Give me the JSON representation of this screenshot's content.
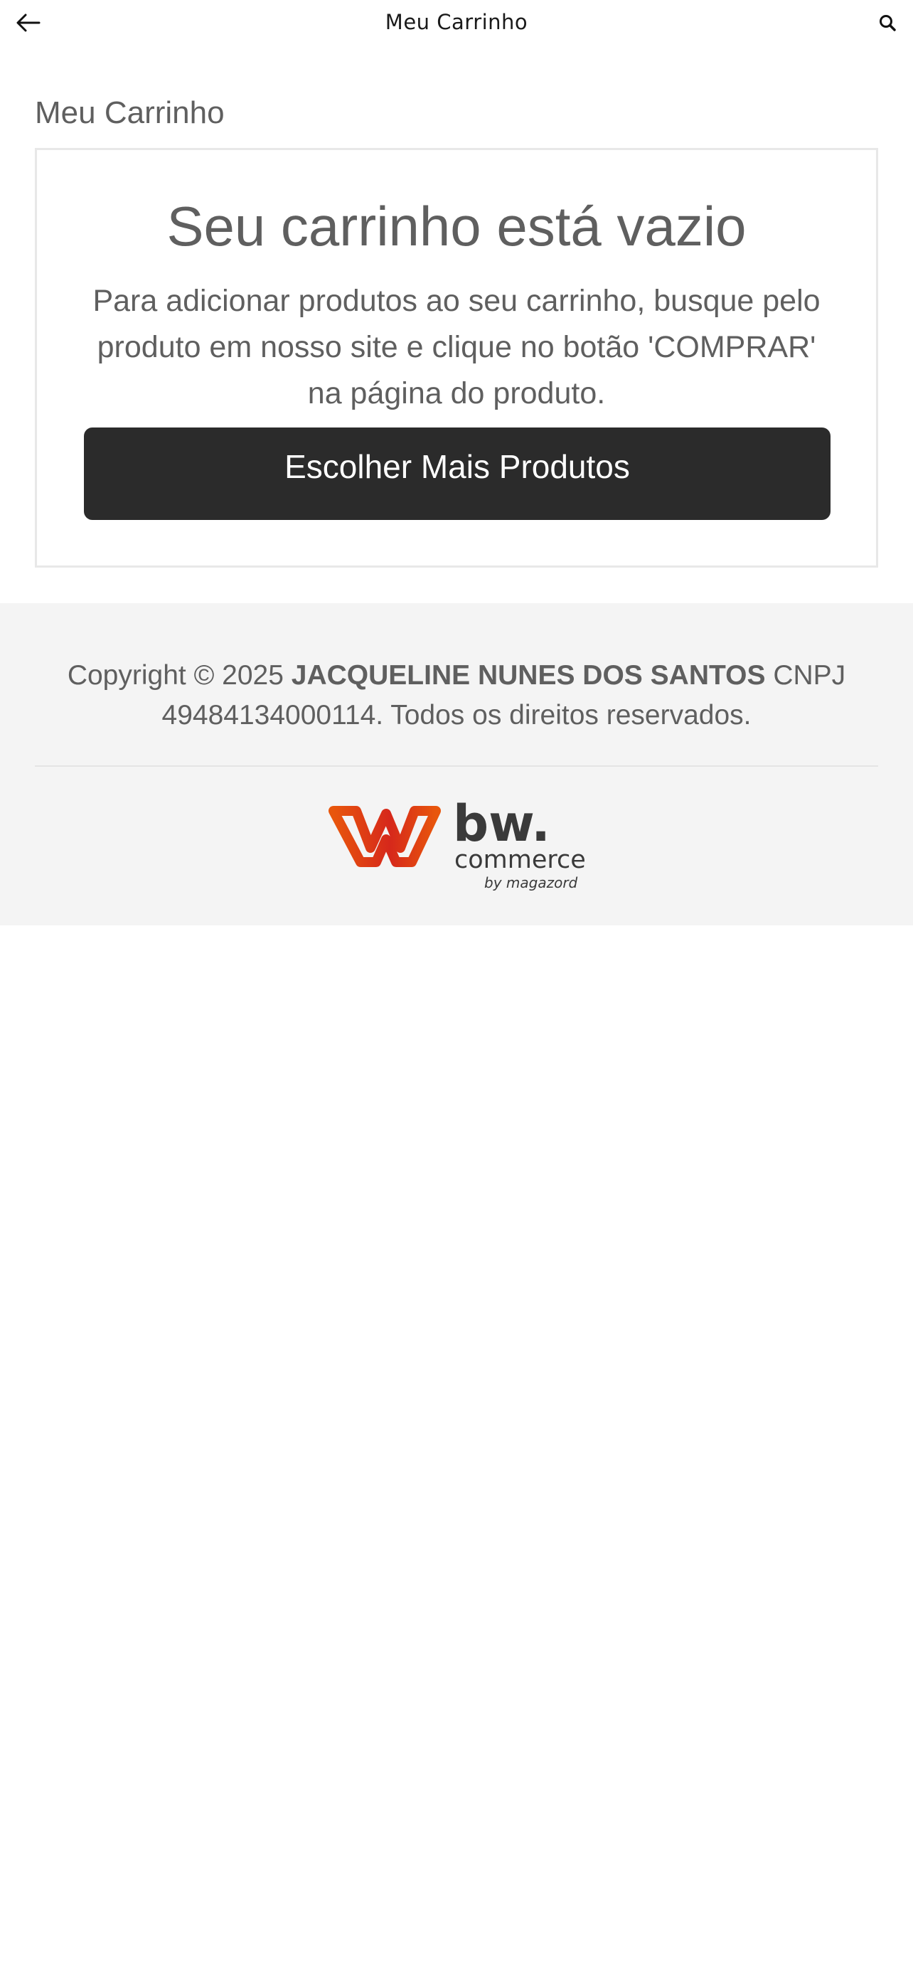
{
  "header": {
    "title": "Meu Carrinho",
    "back_icon": "arrow-left-icon",
    "search_icon": "search-icon"
  },
  "page": {
    "heading": "Meu Carrinho"
  },
  "cart": {
    "empty_title": "Seu carrinho está vazio",
    "empty_text": "Para adicionar produtos ao seu carrinho, busque pelo produto em nosso site e clique no botão 'COMPRAR' na página do produto.",
    "button_label": "Escolher Mais Produtos"
  },
  "footer": {
    "copyright_prefix": "Copyright © 2025",
    "company": "JACQUELINE NUNES DOS SANTOS",
    "copyright_suffix": "CNPJ 49484134000114. Todos os direitos reservados.",
    "logo": {
      "brand": "bw.",
      "sub": "commerce",
      "by": "by magazord"
    }
  },
  "colors": {
    "text": "#5f5f5f",
    "button_bg": "#2b2b2b",
    "footer_bg": "#f4f4f4",
    "logo_orange": "#e8560c",
    "logo_red": "#d6281b",
    "logo_dark": "#3a3a3a"
  }
}
